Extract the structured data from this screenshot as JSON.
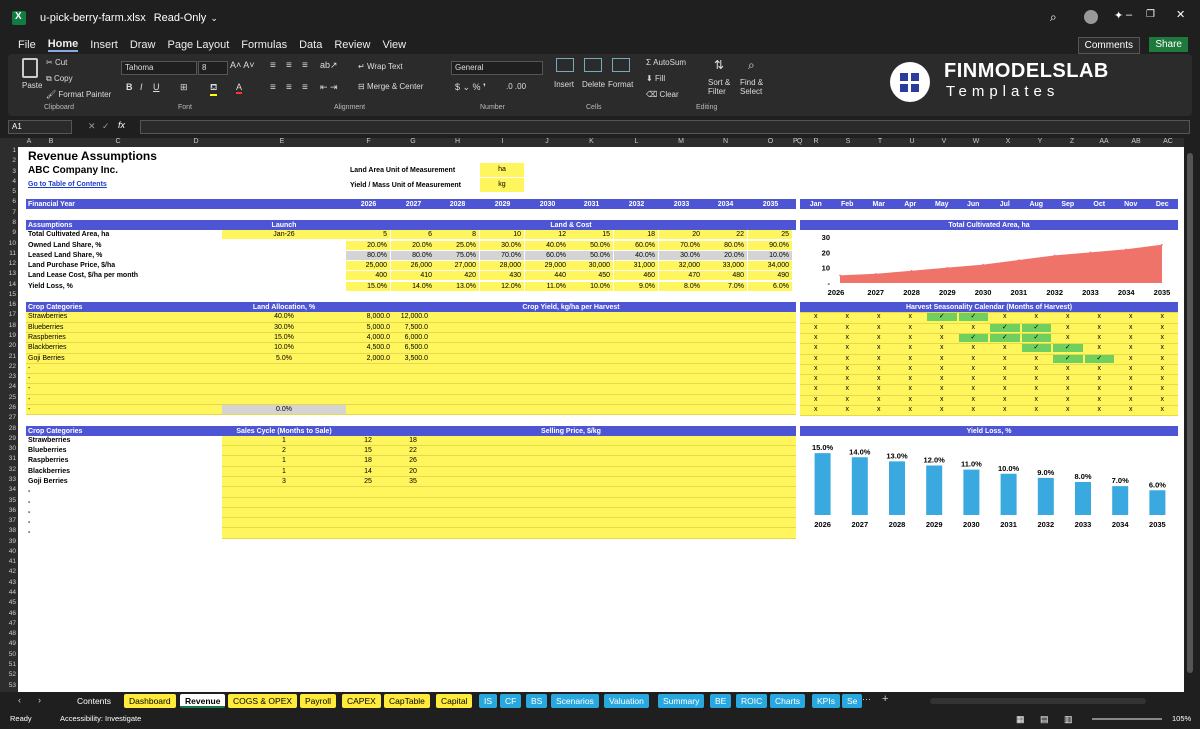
{
  "title_bar": {
    "file_name": "u-pick-berry-farm.xlsx",
    "mode": "Read-Only"
  },
  "menu": [
    "File",
    "Home",
    "Insert",
    "Draw",
    "Page Layout",
    "Formulas",
    "Data",
    "Review",
    "View"
  ],
  "comments_label": "Comments",
  "share_label": "Share",
  "ribbon": {
    "paste": "Paste",
    "cut": "Cut",
    "copy": "Copy",
    "format_painter": "Format Painter",
    "clipboard": "Clipboard",
    "font_name": "Tahoma",
    "font_size": "8",
    "font_group": "Font",
    "wrap_text": "Wrap Text",
    "merge_center": "Merge & Center",
    "alignment": "Alignment",
    "number_format": "General",
    "number": "Number",
    "insert": "Insert",
    "delete": "Delete",
    "format": "Format",
    "cells": "Cells",
    "autosum": "AutoSum",
    "fill": "Fill",
    "clear": "Clear",
    "sort_filter": "Sort & Filter",
    "find_select": "Find & Select",
    "editing": "Editing"
  },
  "brand": {
    "line1": "FINMODELSLAB",
    "line2": "Templates"
  },
  "name_box": "A1",
  "columns": [
    "A",
    "B",
    "C",
    "D",
    "E",
    "F",
    "G",
    "H",
    "I",
    "J",
    "K",
    "L",
    "M",
    "N",
    "O",
    "P",
    "Q",
    "R",
    "S",
    "T",
    "U",
    "V",
    "W",
    "X",
    "Y",
    "Z",
    "AA",
    "AB",
    "AC"
  ],
  "sheet": {
    "title": "Revenue Assumptions",
    "company": "ABC Company Inc.",
    "toc_link": "Go to Table of Contents",
    "land_unit_label": "Land Area Unit of Measurement",
    "land_unit": "ha",
    "mass_unit_label": "Yield / Mass Unit of Measurement",
    "mass_unit": "kg",
    "financial_year_label": "Financial Year",
    "years": [
      "2026",
      "2027",
      "2028",
      "2029",
      "2030",
      "2031",
      "2032",
      "2033",
      "2034",
      "2035"
    ],
    "assumptions_label": "Assumptions",
    "launch_label": "Launch",
    "land_cost_label": "Land & Cost",
    "launch_value": "Jan-26",
    "assumption_rows": [
      {
        "label": "Total Cultivated Area, ha",
        "values": [
          "5",
          "6",
          "8",
          "10",
          "12",
          "15",
          "18",
          "20",
          "22",
          "25"
        ]
      },
      {
        "label": "Owned Land Share, %",
        "values": [
          "20.0%",
          "20.0%",
          "25.0%",
          "30.0%",
          "40.0%",
          "50.0%",
          "60.0%",
          "70.0%",
          "80.0%",
          "90.0%"
        ]
      },
      {
        "label": "Leased Land Share, %",
        "values": [
          "80.0%",
          "80.0%",
          "75.0%",
          "70.0%",
          "60.0%",
          "50.0%",
          "40.0%",
          "30.0%",
          "20.0%",
          "10.0%"
        ]
      },
      {
        "label": "Land Purchase Price, $/ha",
        "values": [
          "25,000",
          "26,000",
          "27,000",
          "28,000",
          "29,000",
          "30,000",
          "31,000",
          "32,000",
          "33,000",
          "34,000"
        ]
      },
      {
        "label": "Land Lease Cost, $/ha per month",
        "values": [
          "400",
          "410",
          "420",
          "430",
          "440",
          "450",
          "460",
          "470",
          "480",
          "490"
        ]
      },
      {
        "label": "Yield Loss, %",
        "values": [
          "15.0%",
          "14.0%",
          "13.0%",
          "12.0%",
          "11.0%",
          "10.0%",
          "9.0%",
          "8.0%",
          "7.0%",
          "6.0%"
        ]
      }
    ],
    "crop_categories_label": "Crop Categories",
    "land_allocation_label": "Land Allocation, %",
    "crop_yield_label": "Crop Yield, kg/ha per Harvest",
    "crops": [
      {
        "name": "Strawberries",
        "alloc": "40.0%",
        "y1": "8,000.0",
        "y2": "12,000.0"
      },
      {
        "name": "Blueberries",
        "alloc": "30.0%",
        "y1": "5,000.0",
        "y2": "7,500.0"
      },
      {
        "name": "Raspberries",
        "alloc": "15.0%",
        "y1": "4,000.0",
        "y2": "6,000.0"
      },
      {
        "name": "Blackberries",
        "alloc": "10.0%",
        "y1": "4,500.0",
        "y2": "6,500.0"
      },
      {
        "name": "Goji Berries",
        "alloc": "5.0%",
        "y1": "2,000.0",
        "y2": "3,500.0"
      },
      {
        "name": "-",
        "alloc": "",
        "y1": "",
        "y2": ""
      },
      {
        "name": "-",
        "alloc": "",
        "y1": "",
        "y2": ""
      },
      {
        "name": "-",
        "alloc": "",
        "y1": "",
        "y2": ""
      },
      {
        "name": "-",
        "alloc": "",
        "y1": "",
        "y2": ""
      },
      {
        "name": "-",
        "alloc": "0.0%",
        "y1": "",
        "y2": ""
      }
    ],
    "sales_cycle_label": "Sales Cycle (Months to Sale)",
    "selling_price_label": "Selling Price, $/kg",
    "sales": [
      {
        "name": "Strawberries",
        "cycle": "1",
        "p1": "12",
        "p2": "18"
      },
      {
        "name": "Blueberries",
        "cycle": "2",
        "p1": "15",
        "p2": "22"
      },
      {
        "name": "Raspberries",
        "cycle": "1",
        "p1": "18",
        "p2": "26"
      },
      {
        "name": "Blackberries",
        "cycle": "1",
        "p1": "14",
        "p2": "20"
      },
      {
        "name": "Goji Berries",
        "cycle": "3",
        "p1": "25",
        "p2": "35"
      },
      {
        "name": "-",
        "cycle": "",
        "p1": "",
        "p2": ""
      },
      {
        "name": "-",
        "cycle": "",
        "p1": "",
        "p2": ""
      },
      {
        "name": "-",
        "cycle": "",
        "p1": "",
        "p2": ""
      },
      {
        "name": "-",
        "cycle": "",
        "p1": "",
        "p2": ""
      },
      {
        "name": "-",
        "cycle": "",
        "p1": "",
        "p2": ""
      }
    ],
    "months": [
      "Jan",
      "Feb",
      "Mar",
      "Apr",
      "May",
      "Jun",
      "Jul",
      "Aug",
      "Sep",
      "Oct",
      "Nov",
      "Dec"
    ],
    "seasonality_title": "Harvest Seasonality Calendar (Months of Harvest)",
    "seasonality": [
      [
        0,
        0,
        0,
        0,
        1,
        1,
        0,
        0,
        0,
        0,
        0,
        0
      ],
      [
        0,
        0,
        0,
        0,
        0,
        0,
        1,
        1,
        0,
        0,
        0,
        0
      ],
      [
        0,
        0,
        0,
        0,
        0,
        1,
        1,
        1,
        0,
        0,
        0,
        0
      ],
      [
        0,
        0,
        0,
        0,
        0,
        0,
        0,
        1,
        1,
        0,
        0,
        0
      ],
      [
        0,
        0,
        0,
        0,
        0,
        0,
        0,
        0,
        1,
        1,
        0,
        0
      ],
      [
        0,
        0,
        0,
        0,
        0,
        0,
        0,
        0,
        0,
        0,
        0,
        0
      ],
      [
        0,
        0,
        0,
        0,
        0,
        0,
        0,
        0,
        0,
        0,
        0,
        0
      ],
      [
        0,
        0,
        0,
        0,
        0,
        0,
        0,
        0,
        0,
        0,
        0,
        0
      ],
      [
        0,
        0,
        0,
        0,
        0,
        0,
        0,
        0,
        0,
        0,
        0,
        0
      ],
      [
        0,
        0,
        0,
        0,
        0,
        0,
        0,
        0,
        0,
        0,
        0,
        0
      ]
    ],
    "seasonality_marks": {
      "yes": "✓",
      "no": "x"
    },
    "colors": {
      "band": "#4e55d4",
      "input": "#fff55c",
      "check": "#6fcf5f",
      "area": "#f0736a",
      "bar": "#3aa9e0"
    }
  },
  "chart_data": [
    {
      "type": "area",
      "title": "Total Cultivated Area, ha",
      "x": [
        "2026",
        "2027",
        "2028",
        "2029",
        "2030",
        "2031",
        "2032",
        "2033",
        "2034",
        "2035"
      ],
      "values": [
        5,
        6,
        8,
        10,
        12,
        15,
        18,
        20,
        22,
        25
      ],
      "ylim": [
        0,
        30
      ],
      "yticks": [
        "30",
        "20",
        "10",
        "-"
      ]
    },
    {
      "type": "bar",
      "title": "Yield Loss, %",
      "categories": [
        "2026",
        "2027",
        "2028",
        "2029",
        "2030",
        "2031",
        "2032",
        "2033",
        "2034",
        "2035"
      ],
      "values": [
        15.0,
        14.0,
        13.0,
        12.0,
        11.0,
        10.0,
        9.0,
        8.0,
        7.0,
        6.0
      ],
      "labels": [
        "15.0%",
        "14.0%",
        "13.0%",
        "12.0%",
        "11.0%",
        "10.0%",
        "9.0%",
        "8.0%",
        "7.0%",
        "6.0%"
      ],
      "ylim": [
        0,
        16
      ]
    }
  ],
  "tabs": [
    {
      "label": "Contents",
      "style": "plain"
    },
    {
      "label": "Dashboard",
      "style": "y"
    },
    {
      "label": "Revenue",
      "style": "active"
    },
    {
      "label": "COGS & OPEX",
      "style": "y"
    },
    {
      "label": "Payroll",
      "style": "y"
    },
    {
      "label": "CAPEX",
      "style": "y"
    },
    {
      "label": "CapTable",
      "style": "y"
    },
    {
      "label": "Capital",
      "style": "y"
    },
    {
      "label": "IS",
      "style": "b"
    },
    {
      "label": "CF",
      "style": "b"
    },
    {
      "label": "BS",
      "style": "b"
    },
    {
      "label": "Scenarios",
      "style": "b"
    },
    {
      "label": "Valuation",
      "style": "b"
    },
    {
      "label": "Summary",
      "style": "b"
    },
    {
      "label": "BE",
      "style": "b"
    },
    {
      "label": "ROIC",
      "style": "b"
    },
    {
      "label": "Charts",
      "style": "b"
    },
    {
      "label": "KPIs",
      "style": "b"
    },
    {
      "label": "Se",
      "style": "b"
    }
  ],
  "status": {
    "ready": "Ready",
    "accessibility": "Accessibility: Investigate",
    "zoom": "105%"
  }
}
